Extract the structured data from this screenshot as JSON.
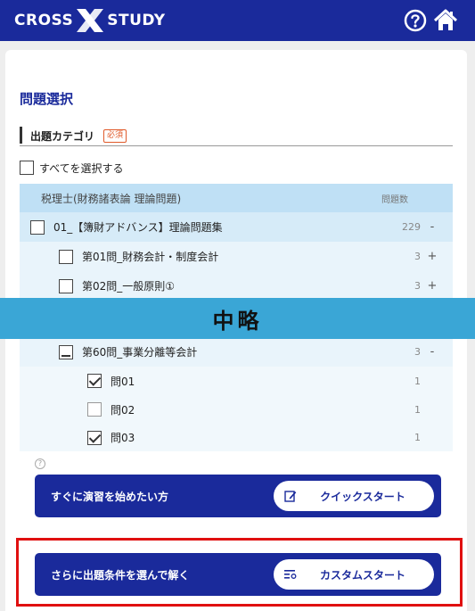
{
  "header": {
    "logo_left": "CROSS",
    "logo_right": "STUDY",
    "help_icon": "question-circle-icon",
    "home_icon": "home-icon",
    "bg_color": "#1a2a9b"
  },
  "page": {
    "title": "問題選択",
    "section_label": "出題カテゴリ",
    "required_badge": "必須",
    "select_all": "すべてを選択する"
  },
  "table": {
    "header_name": "税理士(財務諸表論 理論問題)",
    "header_count": "問題数",
    "parent": {
      "name": "01_【簿財アドバンス】理論問題集",
      "count": "229",
      "expander": "-"
    },
    "children": [
      {
        "name": "第01問_財務会計・制度会計",
        "count": "3",
        "expander": "+"
      },
      {
        "name": "第02問_一般原則①",
        "count": "3",
        "expander": "+"
      }
    ],
    "omitted_label": "中略",
    "last_child": {
      "name": "第60問_事業分離等会計",
      "count": "3",
      "expander": "-"
    },
    "questions": [
      {
        "name": "問01",
        "count": "1",
        "checked": true
      },
      {
        "name": "問02",
        "count": "1",
        "checked": false
      },
      {
        "name": "問03",
        "count": "1",
        "checked": true
      }
    ]
  },
  "actions": {
    "quick": {
      "description": "すぐに演習を始めたい方",
      "button": "クイックスタート",
      "icon": "edit-icon"
    },
    "custom": {
      "description": "さらに出題条件を選んで解く",
      "button": "カスタムスタート",
      "icon": "filter-list-icon"
    }
  },
  "colors": {
    "accent": "#1a2a9b",
    "highlight": "#e01010",
    "omitted_band": "#3aa6d6"
  }
}
